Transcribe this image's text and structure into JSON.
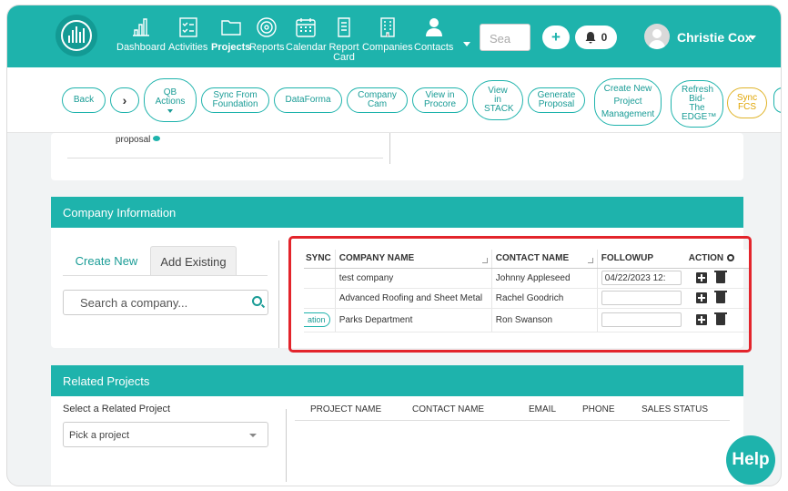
{
  "nav": {
    "items": [
      {
        "label": "Dashboard",
        "icon": "bar-chart-icon"
      },
      {
        "label": "Activities",
        "icon": "checklist-icon"
      },
      {
        "label": "Projects",
        "icon": "folder-icon",
        "active": true
      },
      {
        "label": "Reports",
        "icon": "target-icon"
      },
      {
        "label": "Calendar",
        "icon": "calendar-icon"
      },
      {
        "label": "Report Card",
        "icon": "document-icon"
      },
      {
        "label": "Companies",
        "icon": "building-icon"
      },
      {
        "label": "Contacts",
        "icon": "person-icon"
      }
    ],
    "search_placeholder": "Sea",
    "notification_count": "0",
    "user_name": "Christie Cox",
    "accent_color": "#1eb3ac"
  },
  "actions": [
    {
      "label": "Back"
    },
    {
      "label": "›"
    },
    {
      "label": "QB Actions"
    },
    {
      "label": "Sync From Foundation"
    },
    {
      "label": "DataForma"
    },
    {
      "label": "Company Cam"
    },
    {
      "label": "View in Procore"
    },
    {
      "label": "View in STACK"
    },
    {
      "label": "Generate Proposal"
    },
    {
      "label": "Create New Project Management"
    },
    {
      "label": "Refresh Bid-The EDGE™"
    },
    {
      "label": "Sync FCS"
    }
  ],
  "prev_panel": {
    "text": "proposal"
  },
  "company_info": {
    "title": "Company Information",
    "tab_create": "Create New",
    "tab_existing": "Add Existing",
    "search_placeholder": "Search a company...",
    "columns": [
      "SYNC",
      "COMPANY NAME",
      "CONTACT NAME",
      "FOLLOWUP",
      "ACTION"
    ],
    "rows": [
      {
        "sync": "",
        "company": "test company",
        "contact": "Johnny Appleseed",
        "followup": "04/22/2023 12:"
      },
      {
        "sync": "",
        "company": "Advanced Roofing and Sheet Metal",
        "contact": "Rachel Goodrich",
        "followup": ""
      },
      {
        "sync": "ation",
        "company": "Parks Department",
        "contact": "Ron Swanson",
        "followup": ""
      }
    ]
  },
  "related_projects": {
    "title": "Related Projects",
    "select_label": "Select a Related Project",
    "select_placeholder": "Pick a project",
    "columns": [
      "PROJECT NAME",
      "CONTACT NAME",
      "EMAIL",
      "PHONE",
      "SALES STATUS"
    ]
  },
  "help_label": "Help"
}
